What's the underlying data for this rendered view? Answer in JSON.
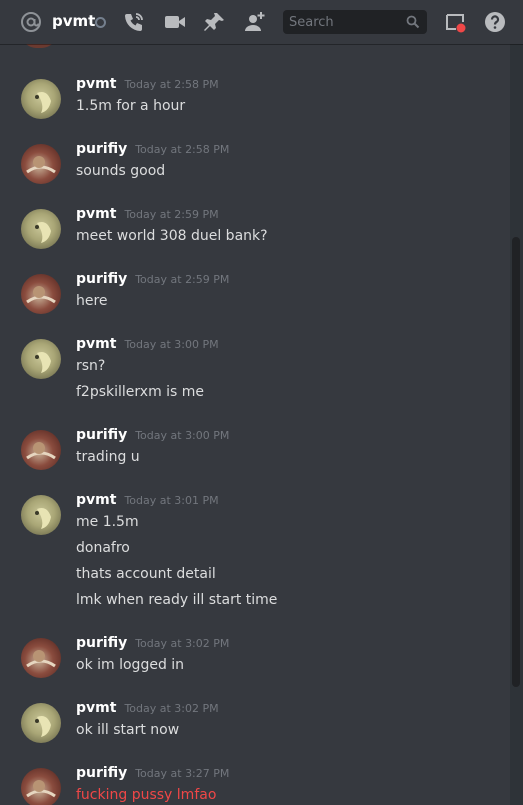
{
  "header": {
    "channel_name": "pvmt",
    "search_placeholder": "Search",
    "icons": [
      "at-icon",
      "status-offline-icon",
      "call-icon",
      "video-icon",
      "pin-icon",
      "add-user-icon",
      "search-icon",
      "inbox-icon",
      "help-icon"
    ],
    "accent_red": "#f04747"
  },
  "messages": [
    {
      "author": "pvmt",
      "time": "Today at 2:58 PM",
      "lines": [
        "1.5m for  a hour"
      ]
    },
    {
      "author": "purifiy",
      "time": "Today at 2:58 PM",
      "lines": [
        "sounds good"
      ]
    },
    {
      "author": "pvmt",
      "time": "Today at 2:59 PM",
      "lines": [
        "meet world 308 duel bank?"
      ]
    },
    {
      "author": "purifiy",
      "time": "Today at 2:59 PM",
      "lines": [
        "here"
      ]
    },
    {
      "author": "pvmt",
      "time": "Today at 3:00 PM",
      "lines": [
        "rsn?",
        "f2pskillerxm is me"
      ]
    },
    {
      "author": "purifiy",
      "time": "Today at 3:00 PM",
      "lines": [
        "trading u"
      ]
    },
    {
      "author": "pvmt",
      "time": "Today at 3:01 PM",
      "lines": [
        "me 1.5m",
        "donafro",
        "thats account detail",
        "lmk when ready ill start time"
      ]
    },
    {
      "author": "purifiy",
      "time": "Today at 3:02 PM",
      "lines": [
        "ok im logged in"
      ]
    },
    {
      "author": "pvmt",
      "time": "Today at 3:02 PM",
      "lines": [
        "ok ill start now"
      ]
    },
    {
      "author": "purifiy",
      "time": "Today at 3:27 PM",
      "lines": [
        "fucking pussy lmfao"
      ]
    }
  ]
}
